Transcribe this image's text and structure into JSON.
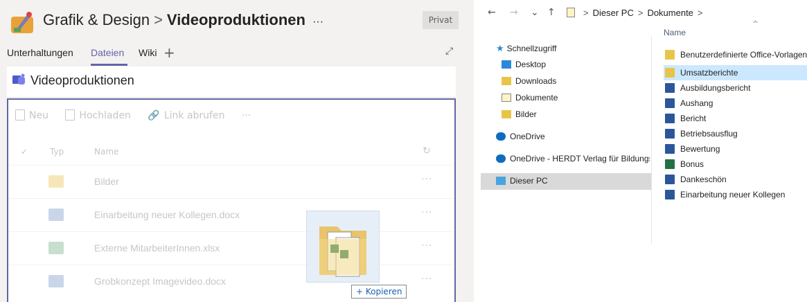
{
  "teams": {
    "team_name": "Grafik & Design",
    "separator": ">",
    "channel_name": "Videoproduktionen",
    "channel_more": "···",
    "privacy_badge": "Privat",
    "tabs": [
      {
        "label": "Unterhaltungen"
      },
      {
        "label": "Dateien"
      },
      {
        "label": "Wiki"
      }
    ],
    "add_tab": "+",
    "expand_icon": "⤢",
    "files_panel_title": "Videoproduktionen",
    "toolbar": {
      "new_label": "Neu",
      "upload_label": "Hochladen",
      "link_label": "Link abrufen",
      "more_label": "···"
    },
    "list_header": {
      "check": "✓",
      "type": "Typ",
      "name": "Name",
      "refresh": "↻"
    },
    "files": [
      {
        "name": "Bilder",
        "kind": "folder-icon"
      },
      {
        "name": "Einarbeitung neuer Kollegen.docx",
        "kind": "word-icon"
      },
      {
        "name": "Externe MitarbeiterInnen.xlsx",
        "kind": "excel-icon"
      },
      {
        "name": "Grobkonzept Imagevideo.docx",
        "kind": "word-icon"
      }
    ],
    "row_more": "···",
    "drag_tooltip": "+ Kopieren"
  },
  "explorer": {
    "back": "←",
    "forward": "→",
    "recent": "⌄",
    "up": "↑",
    "breadcrumb": [
      "Dieser PC",
      "Dokumente"
    ],
    "crumb_sep": ">",
    "column_name": "Name",
    "sort_indicator": "^",
    "nav": {
      "quick_access": "Schnellzugriff",
      "desktop": "Desktop",
      "downloads": "Downloads",
      "dokumente": "Dokumente",
      "bilder": "Bilder",
      "onedrive": "OneDrive",
      "onedrive_herdt": "OneDrive - HERDT Verlag für Bildungs",
      "this_pc": "Dieser PC"
    },
    "items": [
      {
        "name": "Benutzerdefinierte Office-Vorlagen",
        "kind": "folder"
      },
      {
        "name": "Umsatzberichte",
        "kind": "folder"
      },
      {
        "name": "Ausbildungsbericht",
        "kind": "word"
      },
      {
        "name": "Aushang",
        "kind": "word"
      },
      {
        "name": "Bericht",
        "kind": "word"
      },
      {
        "name": "Betriebsausflug",
        "kind": "word"
      },
      {
        "name": "Bewertung",
        "kind": "word"
      },
      {
        "name": "Bonus",
        "kind": "excel"
      },
      {
        "name": "Dankeschön",
        "kind": "word"
      },
      {
        "name": "Einarbeitung neuer Kollegen",
        "kind": "word"
      }
    ]
  }
}
